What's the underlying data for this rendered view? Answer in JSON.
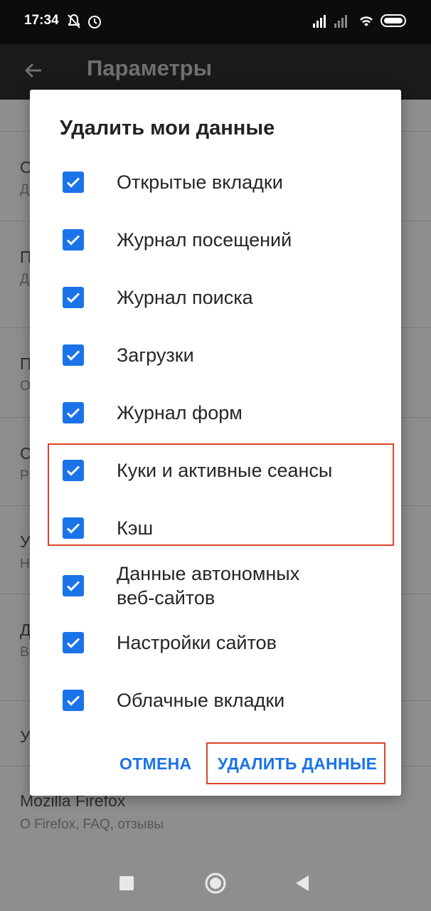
{
  "status_bar": {
    "time": "17:34"
  },
  "toolbar": {
    "title": "Параметры"
  },
  "background": {
    "items": [
      {
        "title": "О",
        "subtitle": "Д"
      },
      {
        "title": "П",
        "subtitle": "Д"
      },
      {
        "title": "П",
        "subtitle": "О"
      },
      {
        "title": "С",
        "subtitle": "Р"
      },
      {
        "title": "У",
        "subtitle": "Н"
      },
      {
        "title": "Д",
        "subtitle": "В"
      },
      {
        "title": "У",
        "subtitle": ""
      }
    ],
    "firefox": {
      "title": "Mozilla Firefox",
      "subtitle": "О Firefox, FAQ, отзывы"
    }
  },
  "dialog": {
    "title": "Удалить мои данные",
    "options": [
      {
        "label": "Открытые вкладки",
        "checked": true
      },
      {
        "label": "Журнал посещений",
        "checked": true
      },
      {
        "label": "Журнал поиска",
        "checked": true
      },
      {
        "label": "Загрузки",
        "checked": true
      },
      {
        "label": "Журнал форм",
        "checked": true
      },
      {
        "label": "Куки и активные сеансы",
        "checked": true
      },
      {
        "label": "Кэш",
        "checked": true
      },
      {
        "label": "Данные автономных",
        "label2": "веб-сайтов",
        "checked": true
      },
      {
        "label": "Настройки сайтов",
        "checked": true
      },
      {
        "label": "Облачные вкладки",
        "checked": true
      }
    ],
    "cancel_label": "ОТМЕНА",
    "confirm_label": "УДАЛИТЬ ДАННЫЕ"
  },
  "colors": {
    "accent": "#1a73e8",
    "highlight": "#e0442a"
  }
}
